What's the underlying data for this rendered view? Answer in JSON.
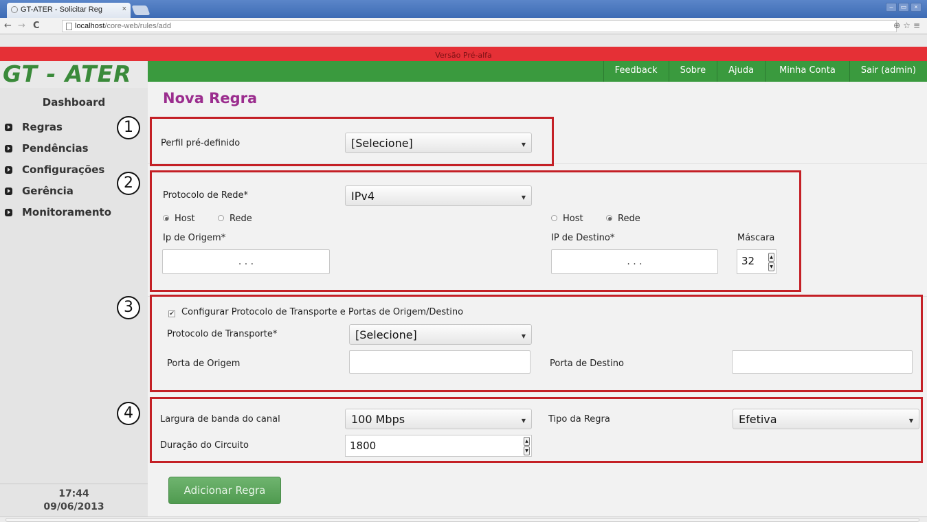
{
  "browser": {
    "tab_title": "GT-ATER - Solicitar Reg ",
    "tab_close": "×",
    "url_host": "localhost",
    "url_path": "/core-web/rules/add",
    "back": "←",
    "forward": "→",
    "reload": "C",
    "right_controls": "⊕☆≡"
  },
  "banner": {
    "text": "Versão Pré-alfa"
  },
  "logo": "GT - ATER",
  "topnav": [
    "Feedback",
    "Sobre",
    "Ajuda",
    "Minha Conta",
    "Sair (admin)"
  ],
  "sidebar": {
    "dashboard": "Dashboard",
    "items": [
      "Regras",
      "Pendências",
      "Configurações",
      "Gerência",
      "Monitoramento"
    ],
    "time": "17:44",
    "date": "09/06/2013"
  },
  "page": {
    "title": "Nova Regra"
  },
  "annotations": [
    "1",
    "2",
    "3",
    "4"
  ],
  "section1": {
    "perfil_label": "Perfil pré-definido",
    "perfil_value": "[Selecione]"
  },
  "section2": {
    "protocolo_label": "Protocolo de Rede*",
    "protocolo_value": "IPv4",
    "origem_radio_host": "Host",
    "origem_radio_rede": "Rede",
    "origem_label": "Ip de Origem*",
    "destino_radio_host": "Host",
    "destino_radio_rede": "Rede",
    "destino_label": "IP de Destino*",
    "mascara_label": "Máscara",
    "mascara_value": "32",
    "ip_dots": ".  .  ."
  },
  "section3": {
    "check_label": "Configurar Protocolo de Transporte e Portas de Origem/Destino",
    "check_mark": "✔",
    "transporte_label": "Protocolo de Transporte*",
    "transporte_value": "[Selecione]",
    "porta_origem_label": "Porta de Origem",
    "porta_destino_label": "Porta de Destino"
  },
  "section4": {
    "largura_label": "Largura de banda do canal",
    "largura_value": "100 Mbps",
    "tipo_label": "Tipo da Regra",
    "tipo_value": "Efetiva",
    "duracao_label": "Duração do Circuito",
    "duracao_value": "1800"
  },
  "submit": "Adicionar Regra",
  "caret": "▼",
  "spin_up": "▲",
  "spin_down": "▼"
}
